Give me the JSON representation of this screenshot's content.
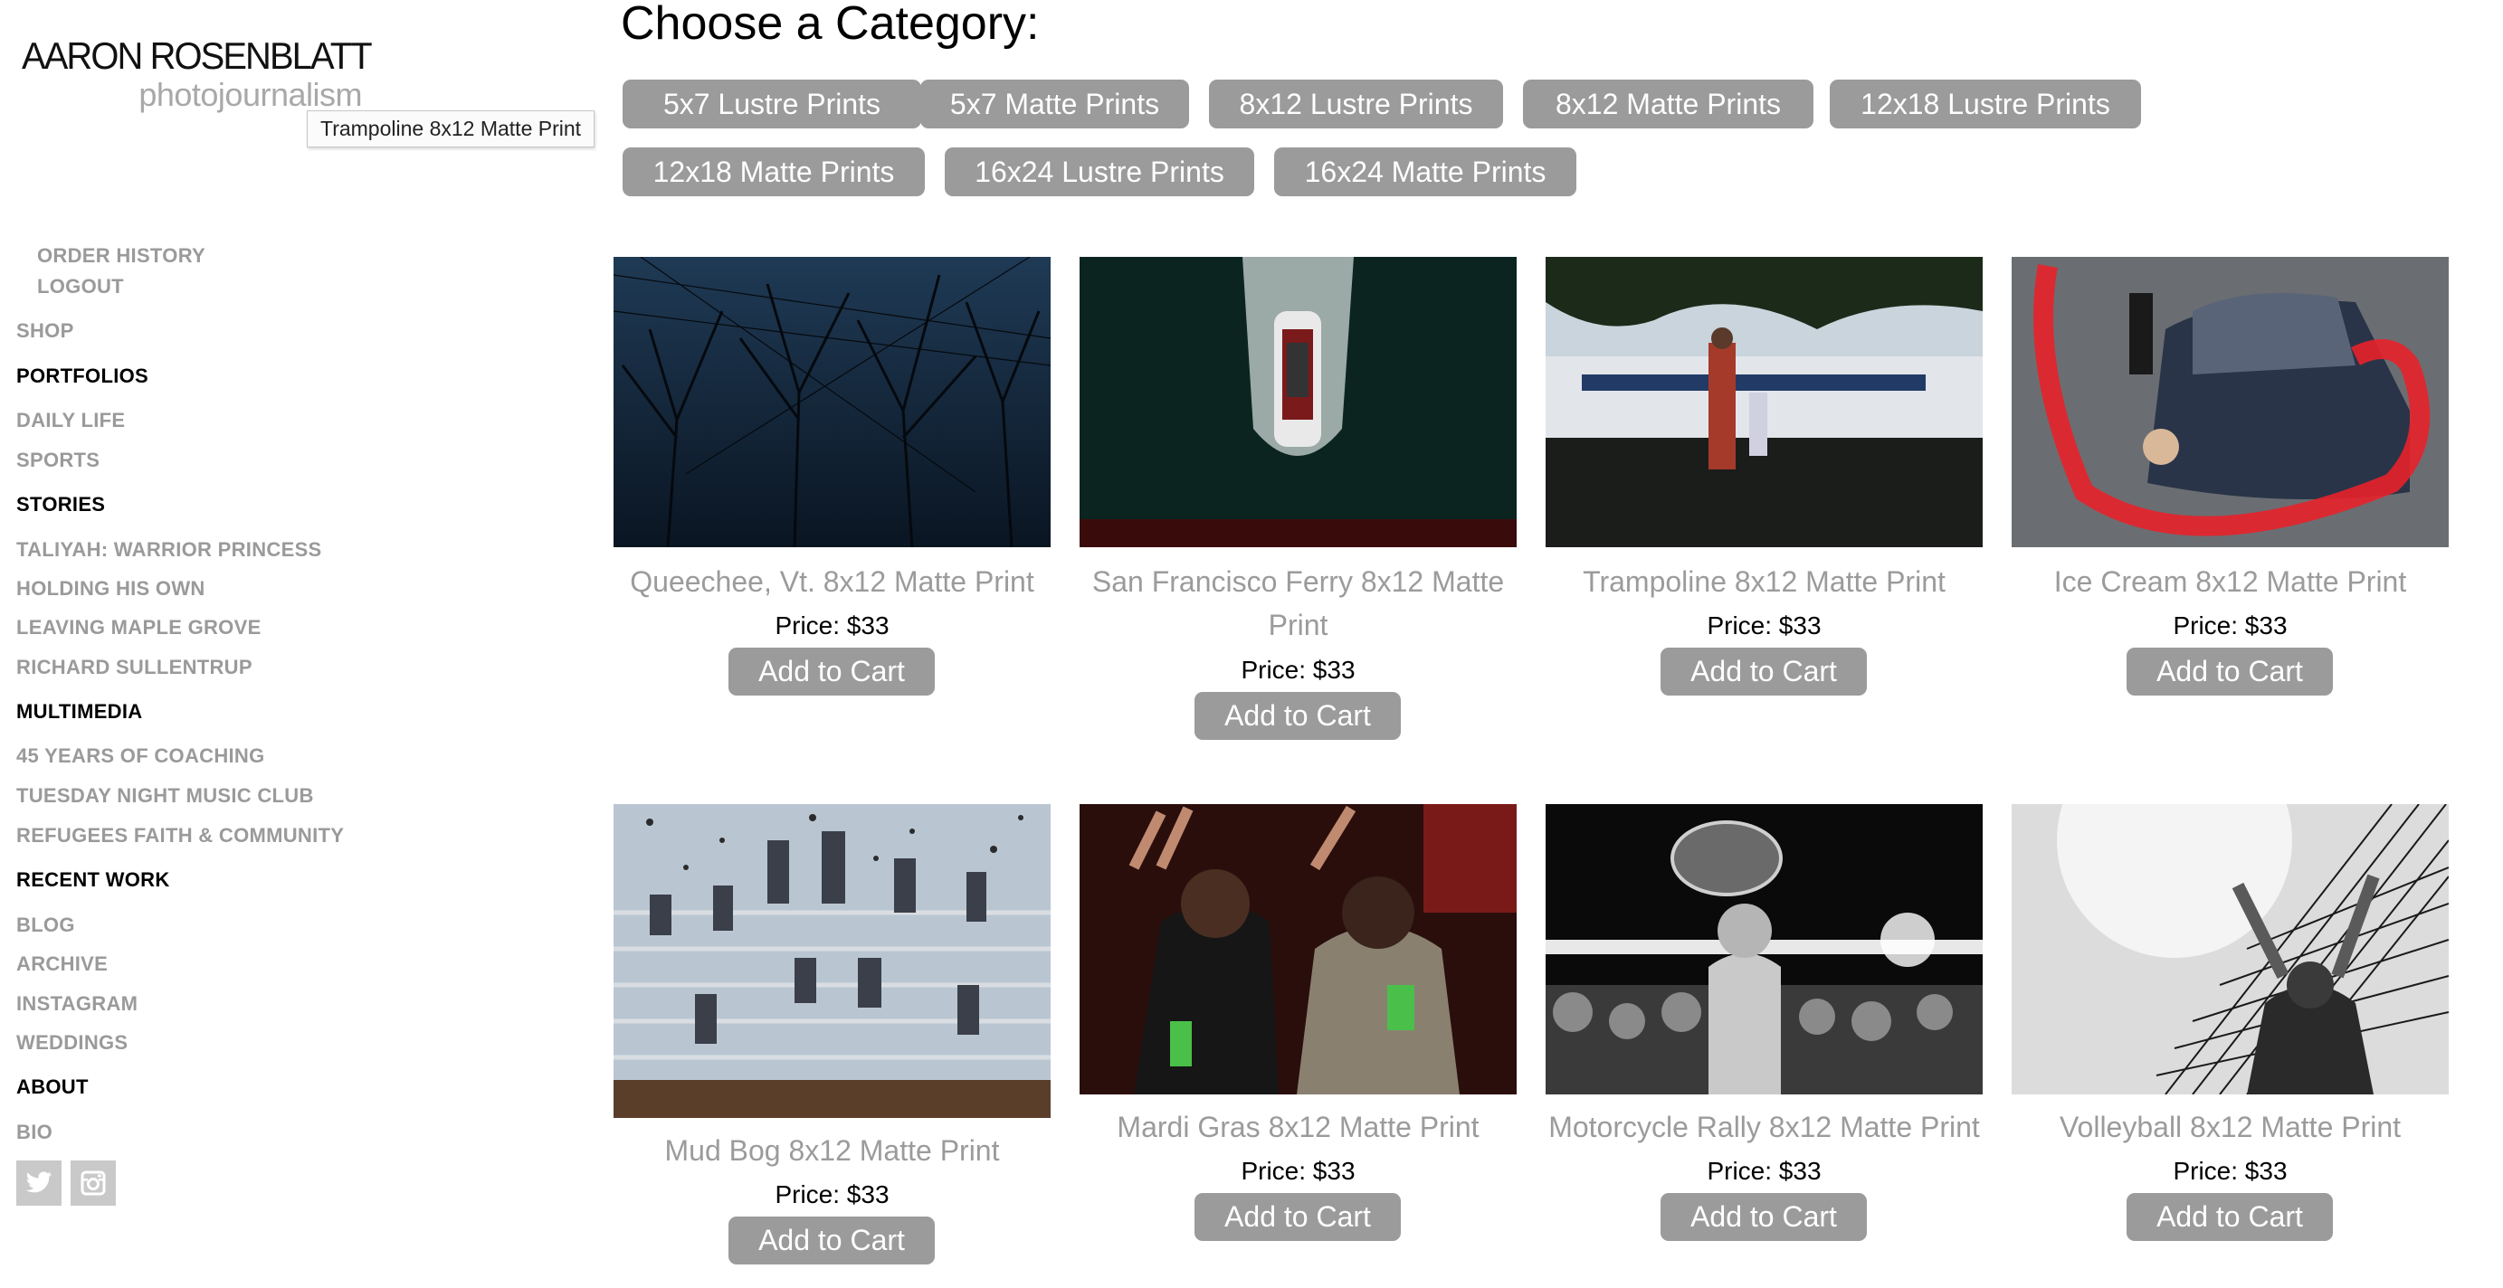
{
  "logo": {
    "name": "AARON ROSENBLATT",
    "subtitle": "photojournalism"
  },
  "tooltip": "Trampoline 8x12 Matte Print",
  "nav": {
    "order_history": "ORDER HISTORY",
    "logout": "LOGOUT",
    "shop": "SHOP",
    "portfolios": "PORTFOLIOS",
    "daily_life": "DAILY LIFE",
    "sports": "SPORTS",
    "stories": "STORIES",
    "taliyah": "TALIYAH: WARRIOR PRINCESS",
    "holding": "HOLDING HIS OWN",
    "maple": "LEAVING MAPLE GROVE",
    "richard": "RICHARD SULLENTRUP",
    "multimedia": "MULTIMEDIA",
    "coaching": "45 YEARS OF COACHING",
    "tuesday": "TUESDAY NIGHT MUSIC CLUB",
    "refugees": "REFUGEES FAITH & COMMUNITY",
    "recent": "RECENT WORK",
    "blog": "BLOG",
    "archive": "ARCHIVE",
    "instagram": "INSTAGRAM",
    "weddings": "WEDDINGS",
    "about": "ABOUT",
    "bio": "BIO"
  },
  "social": {
    "twitter_icon": "twitter-icon",
    "instagram_icon": "instagram-icon"
  },
  "heading": "Choose a Category:",
  "categories": [
    "5x7 Lustre Prints",
    "5x7 Matte Prints",
    "8x12 Lustre Prints",
    "8x12 Matte Prints",
    "12x18 Lustre Prints",
    "12x18 Matte Prints",
    "16x24 Lustre Prints",
    "16x24 Matte Prints"
  ],
  "products": [
    {
      "title_1": "Queechee, Vt. 8x12 Matte Print",
      "title_2": "",
      "price": "Price: $33",
      "button": "Add to Cart"
    },
    {
      "title_1": "San Francisco Ferry 8x12 Matte",
      "title_2": "Print",
      "price": "Price: $33",
      "button": "Add to Cart"
    },
    {
      "title_1": "Trampoline 8x12 Matte Print",
      "title_2": "",
      "price": "Price: $33",
      "button": "Add to Cart"
    },
    {
      "title_1": "Ice Cream 8x12 Matte Print",
      "title_2": "",
      "price": "Price: $33",
      "button": "Add to Cart"
    },
    {
      "title_1": "Mud Bog 8x12 Matte Print",
      "title_2": "",
      "price": "Price: $33",
      "button": "Add to Cart"
    },
    {
      "title_1": "Mardi Gras 8x12 Matte Print",
      "title_2": "",
      "price": "Price: $33",
      "button": "Add to Cart"
    },
    {
      "title_1": "Motorcycle Rally 8x12 Matte Print",
      "title_2": "",
      "price": "Price: $33",
      "button": "Add to Cart"
    },
    {
      "title_1": "Volleyball 8x12 Matte Print",
      "title_2": "",
      "price": "Price: $33",
      "button": "Add to Cart"
    }
  ]
}
